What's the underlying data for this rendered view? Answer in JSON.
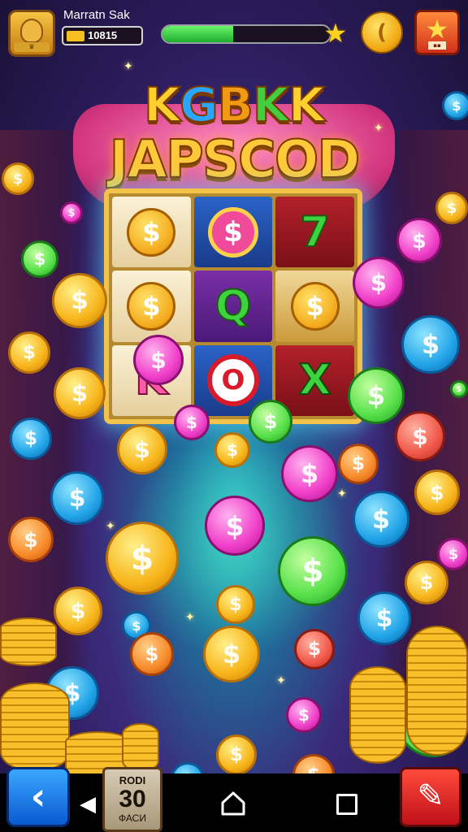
{
  "hud": {
    "player_name": "Marratn Sak",
    "balance": "10815",
    "xp_progress": 0.42,
    "avatar_icon": "helmet-icon",
    "coin_icon": "coin-icon",
    "star_icon": "star-icon"
  },
  "title": {
    "top_letters": [
      "K",
      "G",
      "B",
      "K",
      "K"
    ],
    "main": "JAPSCOD"
  },
  "reels": {
    "symbols": [
      {
        "type": "coin",
        "text": "$",
        "bg": "cream"
      },
      {
        "type": "pink",
        "text": "$",
        "bg": "blue"
      },
      {
        "type": "seven",
        "text": "7",
        "bg": "red"
      },
      {
        "type": "coin",
        "text": "$",
        "bg": "cream"
      },
      {
        "type": "q",
        "text": "Q",
        "bg": "purple"
      },
      {
        "type": "coin",
        "text": "$",
        "bg": "tan"
      },
      {
        "type": "k",
        "text": "K",
        "bg": "cream"
      },
      {
        "type": "o",
        "text": "O",
        "bg": "blue"
      },
      {
        "type": "x",
        "text": "X",
        "bg": "red"
      }
    ]
  },
  "bottom": {
    "back_icon": "chevron-left-icon",
    "prev_icon": "triangle-left-icon",
    "round_top": "RODI",
    "round_value": "30",
    "round_bottom": "ФАСИ",
    "home_icon": "home-icon",
    "recents_icon": "square-icon",
    "edit_icon": "pencil-icon"
  },
  "colors": {
    "accent_gold": "#f7b51a",
    "banner_pink": "#d3367e",
    "xp_green": "#1fae2f"
  }
}
